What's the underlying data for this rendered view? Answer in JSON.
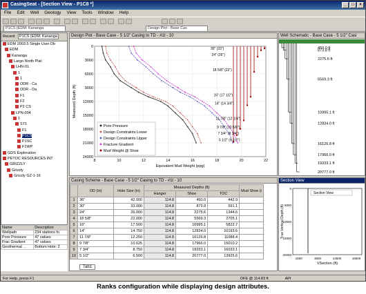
{
  "app": {
    "title": "CasingSeat - [Section View - P1C8 *]",
    "window_buttons": [
      "_",
      "□",
      "×"
    ]
  },
  "menu": [
    "File",
    "Edit",
    "Well",
    "Geology",
    "View",
    "Tools",
    "Window",
    "Help"
  ],
  "toolbar": {
    "well_selector": "P1CS (EDM: Kananga",
    "design_selector": "Design Plot - Base Cas"
  },
  "tree": {
    "tab_recent": "Recent",
    "combo": "P1CS (EDM: Kananga",
    "items": [
      "EDM 2003.5 Single User Db",
      "EDM",
      "Kananga",
      "Largo North Plat",
      "LHN-01",
      "1",
      "1",
      "ODR - Ca",
      "ODR - Da",
      "F1",
      "F2",
      "P2 CS",
      "LPN-004",
      "1",
      "ST1",
      "F1",
      "P1CS",
      "P1SC",
      "F1WP",
      "GDS Exploration",
      "PETOC RESOURCES INT",
      "GRIZZLY",
      "Grizzly",
      "Grizzly GZ-1-16"
    ]
  },
  "attributes": {
    "headers": [
      "Name",
      "Description"
    ],
    "rows": [
      [
        "Wellpath",
        "234 stations fo"
      ],
      [
        "Pore Pressure",
        "47 values"
      ],
      [
        "Frac Gradient",
        "47 values"
      ],
      [
        "Geothermal ...",
        "Bottom Hole: 2"
      ]
    ]
  },
  "design_plot": {
    "title": "Design Plot - Base Case - 5 1/2\" Casing to TD - #1t - 10",
    "xlabel": "Equivalent Mud Weight (ppg)",
    "ylabel": "Measured Depth (ft)",
    "xticks": [
      "8",
      "10",
      "12",
      "14",
      "16",
      "18",
      "20",
      "22"
    ],
    "yticks": [
      "0",
      "3000",
      "6000",
      "9000",
      "12000",
      "15000",
      "18000",
      "21000",
      "24000"
    ],
    "legend": [
      "Pore Pressure",
      "Design Constraints Lower",
      "Design Constraints Upper",
      "Fracture Gradient",
      "Mud Weight @ Shoe"
    ],
    "casing_labels": [
      "30\" (33\")",
      "24\" (26\")",
      "18 5/8\" (22\")",
      "16\" (17 1/2\")",
      "14\" (14 3/4\")",
      "11 7/8\" (12 1/4\")",
      "9 7/8\" (10 5/8\")",
      "7 3/4\" (8 3/4\")",
      "5 1/2\" (6 1/2\")"
    ]
  },
  "chart_data": {
    "type": "line",
    "title": "Design Plot - Base Case - 5 1/2\" Casing to TD - #1t - 10",
    "xlabel": "Equivalent Mud Weight (ppg)",
    "ylabel": "Measured Depth (ft)",
    "xlim": [
      8,
      22
    ],
    "ylim": [
      24000,
      0
    ],
    "series": [
      {
        "name": "Pore Pressure",
        "color": "#333333",
        "x": [
          8.6,
          8.7,
          8.9,
          9.3,
          9.6,
          10.1,
          11.0,
          11.6,
          12.4,
          13.4,
          14.0,
          14.6,
          15.2,
          15.6,
          16.0,
          16.3
        ],
        "y": [
          0,
          1500,
          3000,
          4500,
          6000,
          7500,
          9000,
          10000,
          11000,
          12000,
          13000,
          14500,
          16000,
          17500,
          19000,
          21000
        ]
      },
      {
        "name": "Design Constraints Lower",
        "color": "#c06060",
        "x": [
          8.9,
          9.0,
          9.3,
          9.7,
          10.0,
          10.5,
          11.4,
          12.0,
          12.8,
          13.8,
          14.4,
          15.0,
          15.6,
          16.0,
          16.4,
          16.7
        ],
        "y": [
          0,
          1500,
          3000,
          4500,
          6000,
          7500,
          9000,
          10000,
          11000,
          12000,
          13000,
          14500,
          16000,
          17500,
          19000,
          21000
        ]
      },
      {
        "name": "Design Constraints Upper",
        "color": "#6060c0",
        "x": [
          10.8,
          11.0,
          11.5,
          12.2,
          12.8,
          13.5,
          14.4,
          15.0,
          15.8,
          16.4,
          17.0,
          17.6,
          18.2,
          18.6,
          19.0,
          19.3
        ],
        "y": [
          0,
          1500,
          3000,
          4500,
          6000,
          7500,
          9000,
          10000,
          11000,
          12000,
          13000,
          14500,
          16000,
          17500,
          19000,
          21000
        ]
      },
      {
        "name": "Fracture Gradient",
        "color": "#d040d0",
        "x": [
          11.2,
          11.4,
          11.9,
          12.6,
          13.2,
          13.9,
          14.8,
          15.4,
          16.2,
          16.8,
          17.4,
          18.0,
          18.6,
          19.0,
          19.4,
          19.7
        ],
        "y": [
          0,
          1500,
          3000,
          4500,
          6000,
          7500,
          9000,
          10000,
          11000,
          12000,
          13000,
          14500,
          16000,
          17500,
          19000,
          21000
        ]
      }
    ]
  },
  "schematic": {
    "title": "Well Schematic - Base Case - 5 1/2\" Casi",
    "depths": [
      "450.0 ft",
      "873.8 ft",
      "2275.6 ft",
      "5569.3 ft",
      "10995.1 ft",
      "12834.0 ft",
      "16126.8 ft",
      "17966.0 ft",
      "19333.1 ft",
      "20777.0 ft"
    ]
  },
  "section": {
    "title": "Section View",
    "legend": "Section View",
    "ylabel": "True Vertical Depth (ft)",
    "xlabel": "VSection (ft)",
    "xticks": [
      "-1500",
      "3500",
      "13500",
      "18500"
    ],
    "yticks": [
      "0",
      "5000",
      "10000",
      "15000",
      "20000"
    ]
  },
  "casing_scheme": {
    "title": "Casing Scheme - Base Case - 5 1/2\" Casing to TD - #1t - 10",
    "headers": [
      "OD (in)",
      "Hole Size (in)",
      "Hanger",
      "Shoe",
      "TOC",
      "Mud Shoe (i"
    ],
    "group_header": "Measured Depths (ft)",
    "rows": [
      [
        "1",
        "36\"",
        "42.000",
        "114.8",
        "450.0",
        "442.9"
      ],
      [
        "2",
        "30\"",
        "33.000",
        "114.8",
        "873.8",
        "591.1"
      ],
      [
        "3",
        "24\"",
        "26.000",
        "114.8",
        "2275.6",
        "1344.6"
      ],
      [
        "4",
        "18 5/8\"",
        "22.000",
        "114.8",
        "5569.3",
        "2705.1"
      ],
      [
        "5",
        "16\"",
        "17.500",
        "114.8",
        "10995.1",
        "5822.7"
      ],
      [
        "6",
        "14\"",
        "14.750",
        "114.8",
        "12834.0",
        "10193.6"
      ],
      [
        "7",
        "11 7/8\"",
        "12.250",
        "114.8",
        "16126.8",
        "11088.4"
      ],
      [
        "8",
        "9 7/8\"",
        "10.625",
        "114.8",
        "17966.0",
        "15010.2"
      ],
      [
        "9",
        "7 3/4\"",
        "8.750",
        "114.8",
        "19333.1",
        "16033.1"
      ],
      [
        "10",
        "5 1/2\"",
        "6.500",
        "114.8",
        "20777.0",
        "13925.6"
      ]
    ],
    "tab": "Tab1"
  },
  "statusbar": {
    "help": "For Help, press F1",
    "dfe": "DFE @ 114.83 ft",
    "api": "API"
  },
  "caption": "Ranks configuration while displaying design attributes."
}
